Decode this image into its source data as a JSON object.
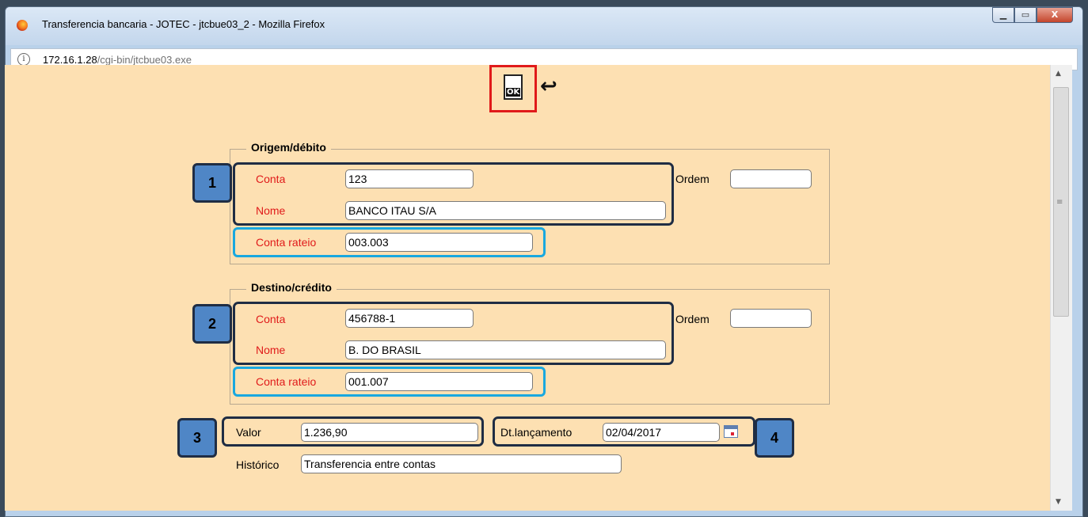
{
  "window": {
    "title": "Transferencia bancaria - JOTEC - jtcbue03_2 - Mozilla Firefox",
    "controls": {
      "minimize": "▁",
      "maximize": "▭",
      "close": "X"
    }
  },
  "address_bar": {
    "host": "172.16.1.28",
    "path": "/cgi-bin/jtcbue03.exe"
  },
  "toolbar": {
    "ok_label": "OK"
  },
  "origem": {
    "legend": "Origem/débito",
    "conta_label": "Conta",
    "conta_value": "123",
    "nome_label": "Nome",
    "nome_value": "BANCO ITAU S/A",
    "ordem_label": "Ordem",
    "ordem_value": "",
    "rateio_label": "Conta rateio",
    "rateio_value": "003.003"
  },
  "destino": {
    "legend": "Destino/crédito",
    "conta_label": "Conta",
    "conta_value": "456788-1",
    "nome_label": "Nome",
    "nome_value": "B. DO BRASIL",
    "ordem_label": "Ordem",
    "ordem_value": "",
    "rateio_label": "Conta rateio",
    "rateio_value": "001.007"
  },
  "valor": {
    "label": "Valor",
    "value": "1.236,90"
  },
  "dt_lancamento": {
    "label": "Dt.lançamento",
    "value": "02/04/2017"
  },
  "historico": {
    "label": "Histórico",
    "value": "Transferencia entre contas"
  },
  "badges": [
    "1",
    "2",
    "3",
    "4"
  ],
  "colors": {
    "required_label": "#e01a1a",
    "background": "#fde0b2",
    "highlight_cyan": "#19a8df",
    "badge": "#4f86c6"
  }
}
